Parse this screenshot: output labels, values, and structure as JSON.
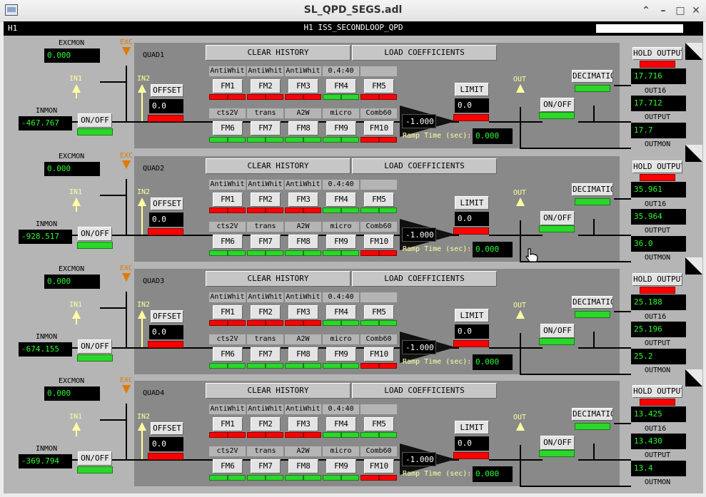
{
  "window": {
    "title": "SL_QPD_SEGS.adl"
  },
  "header": {
    "site": "H1",
    "system": "H1 ISS_SECONDLOOP_QPD"
  },
  "labels": {
    "excmon": "EXCMON",
    "exc": "EXC",
    "in1": "IN1",
    "in2": "IN2",
    "inmon": "INMON",
    "onoff": "ON/OFF",
    "offset": "OFFSET",
    "clear": "CLEAR HISTORY",
    "load": "LOAD COEFFICIENTS",
    "limit": "LIMIT",
    "out": "OUT",
    "decimation": "DECIMATION",
    "hold": "HOLD OUTPUT",
    "out16": "OUT16",
    "output": "OUTPUT",
    "outmon": "OUTMON",
    "ramp": "Ramp Time (sec):"
  },
  "filters": {
    "names_row1": [
      "AntiWhit",
      "AntiWhit",
      "AntiWhit",
      "0.4:40",
      ""
    ],
    "names_row2": [
      "cts2V",
      "trans",
      "A2W",
      "micro",
      "Comb60"
    ],
    "buttons_row1": [
      "FM1",
      "FM2",
      "FM3",
      "FM4",
      "FM5"
    ],
    "buttons_row2": [
      "FM6",
      "FM7",
      "FM8",
      "FM9",
      "FM10"
    ]
  },
  "quads": [
    {
      "name": "QUAD1",
      "excmon": "0.000",
      "inmon": "-467.767",
      "offset": "0.0",
      "gain": "-1.000",
      "limit": "0.0",
      "ramp": "0.000",
      "out16": "17.716",
      "output": "17.712",
      "outmon": "17.7",
      "row1_status": [
        [
          "r",
          "r"
        ],
        [
          "r",
          "r"
        ],
        [
          "r",
          "r"
        ],
        [
          "g",
          "g"
        ],
        [
          "r",
          "r"
        ]
      ],
      "row2_status": [
        [
          "g",
          "g"
        ],
        [
          "g",
          "g"
        ],
        [
          "g",
          "g"
        ],
        [
          "g",
          "g"
        ],
        [
          "r",
          "r"
        ]
      ]
    },
    {
      "name": "QUAD2",
      "excmon": "0.000",
      "inmon": "-928.517",
      "offset": "0.0",
      "gain": "-1.000",
      "limit": "0.0",
      "ramp": "0.000",
      "out16": "35.961",
      "output": "35.964",
      "outmon": "36.0",
      "row1_status": [
        [
          "r",
          "r"
        ],
        [
          "r",
          "r"
        ],
        [
          "r",
          "r"
        ],
        [
          "g",
          "g"
        ],
        [
          "g",
          "g"
        ]
      ],
      "row2_status": [
        [
          "g",
          "g"
        ],
        [
          "g",
          "g"
        ],
        [
          "g",
          "g"
        ],
        [
          "g",
          "g"
        ],
        [
          "r",
          "r"
        ]
      ]
    },
    {
      "name": "QUAD3",
      "excmon": "0.000",
      "inmon": "-674.155",
      "offset": "0.0",
      "gain": "-1.000",
      "limit": "0.0",
      "ramp": "0.000",
      "out16": "25.188",
      "output": "25.196",
      "outmon": "25.2",
      "row1_status": [
        [
          "r",
          "r"
        ],
        [
          "r",
          "r"
        ],
        [
          "r",
          "r"
        ],
        [
          "g",
          "g"
        ],
        [
          "g",
          "g"
        ]
      ],
      "row2_status": [
        [
          "g",
          "g"
        ],
        [
          "g",
          "g"
        ],
        [
          "g",
          "g"
        ],
        [
          "g",
          "g"
        ],
        [
          "r",
          "r"
        ]
      ]
    },
    {
      "name": "QUAD4",
      "excmon": "0.000",
      "inmon": "-369.794",
      "offset": "0.0",
      "gain": "-1.000",
      "limit": "0.0",
      "ramp": "0.000",
      "out16": "13.425",
      "output": "13.430",
      "outmon": "13.4",
      "row1_status": [
        [
          "r",
          "r"
        ],
        [
          "r",
          "r"
        ],
        [
          "r",
          "r"
        ],
        [
          "g",
          "g"
        ],
        [
          "g",
          "g"
        ]
      ],
      "row2_status": [
        [
          "g",
          "g"
        ],
        [
          "g",
          "g"
        ],
        [
          "g",
          "g"
        ],
        [
          "g",
          "g"
        ],
        [
          "r",
          "r"
        ]
      ]
    }
  ],
  "colors": {
    "background": "#b5b5b5",
    "panel": "#898989",
    "readback_text": "#2dfb2d",
    "on_indicator": "#2ad72a",
    "off_indicator": "#ff0000",
    "exc_label": "#e07a00",
    "io_label": "#ffffa0"
  }
}
